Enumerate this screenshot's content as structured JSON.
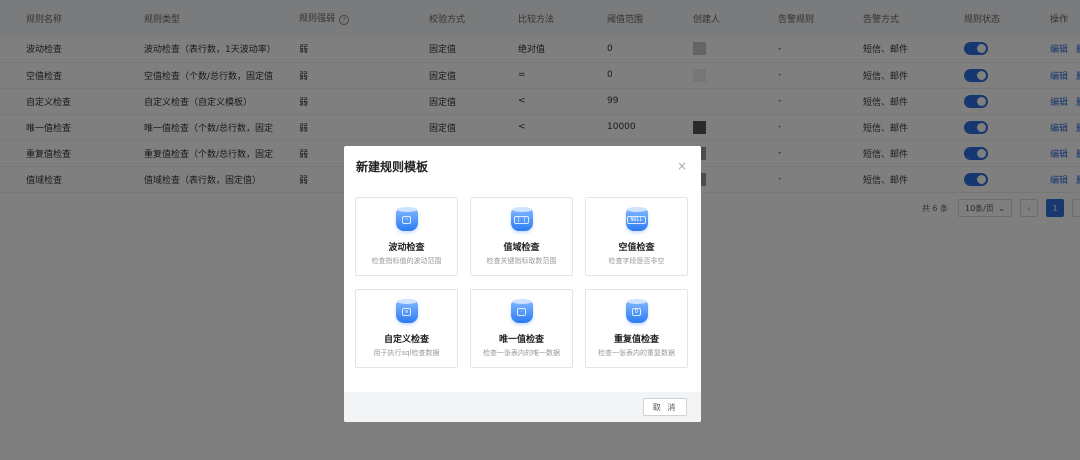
{
  "table": {
    "headers": [
      "规则名称",
      "规则类型",
      "规则强弱",
      "校验方式",
      "比较方法",
      "阈值范围",
      "创建人",
      "告警规则",
      "告警方式",
      "规则状态",
      "操作"
    ],
    "rows": [
      {
        "name": "波动检查",
        "type": "波动检查（表行数，1天波动率）",
        "strength": "弱",
        "method": "固定值",
        "compare": "绝对值",
        "threshold": "0",
        "creator_color": "#c9c9c9",
        "alarm_rule": "-",
        "alarm_way": "短信、邮件",
        "status_on": true
      },
      {
        "name": "空值检查",
        "type": "空值检查（个数/总行数，固定值）",
        "strength": "弱",
        "method": "固定值",
        "compare": "=",
        "threshold": "0",
        "creator_color": "#ececec",
        "alarm_rule": "-",
        "alarm_way": "短信、邮件",
        "status_on": true
      },
      {
        "name": "自定义检查",
        "type": "自定义检查（自定义模板）",
        "strength": "弱",
        "method": "固定值",
        "compare": "<",
        "threshold": "99",
        "creator_color": "#ffffff",
        "alarm_rule": "-",
        "alarm_way": "短信、邮件",
        "status_on": true
      },
      {
        "name": "唯一值检查",
        "type": "唯一值检查（个数/总行数，固定值）",
        "strength": "弱",
        "method": "固定值",
        "compare": "<",
        "threshold": "10000",
        "creator_color": "#555555",
        "alarm_rule": "-",
        "alarm_way": "短信、邮件",
        "status_on": true
      },
      {
        "name": "重复值检查",
        "type": "重复值检查（个数/总行数，固定值）",
        "strength": "弱",
        "method": "",
        "compare": "",
        "threshold": "",
        "creator_color": "#9a9a9a",
        "alarm_rule": "-",
        "alarm_way": "短信、邮件",
        "status_on": true
      },
      {
        "name": "值域检查",
        "type": "值域检查（表行数，固定值）",
        "strength": "弱",
        "method": "",
        "compare": "",
        "threshold": "",
        "creator_color": "#9a9a9a",
        "alarm_rule": "-",
        "alarm_way": "短信、邮件",
        "status_on": true
      }
    ],
    "op_edit": "编辑",
    "op_delete": "删除"
  },
  "pager": {
    "total": "共 6 条",
    "page_size": "10条/页",
    "current_page": "1"
  },
  "modal": {
    "title": "新建规则模板",
    "close": "×",
    "cancel": "取 消",
    "cards": [
      {
        "title": "波动检查",
        "desc": "检查指标值的波动范围",
        "icon": "fluctuation-icon",
        "glyph": "~"
      },
      {
        "title": "值域检查",
        "desc": "检查关键指标取数范围",
        "icon": "range-icon",
        "glyph": "[ ]"
      },
      {
        "title": "空值检查",
        "desc": "检查字段是否非空",
        "icon": "null-icon",
        "glyph": "NULL"
      },
      {
        "title": "自定义检查",
        "desc": "用于执行sql检查数据",
        "icon": "custom-icon",
        "glyph": "≡"
      },
      {
        "title": "唯一值检查",
        "desc": "检查一张表内的唯一数据",
        "icon": "unique-icon",
        "glyph": "·"
      },
      {
        "title": "重复值检查",
        "desc": "检查一张表内的重复数据",
        "icon": "duplicate-icon",
        "glyph": "D"
      }
    ]
  },
  "colors": {
    "primary": "#2f6fe0",
    "overlay": "rgba(0,0,0,0.5)"
  }
}
